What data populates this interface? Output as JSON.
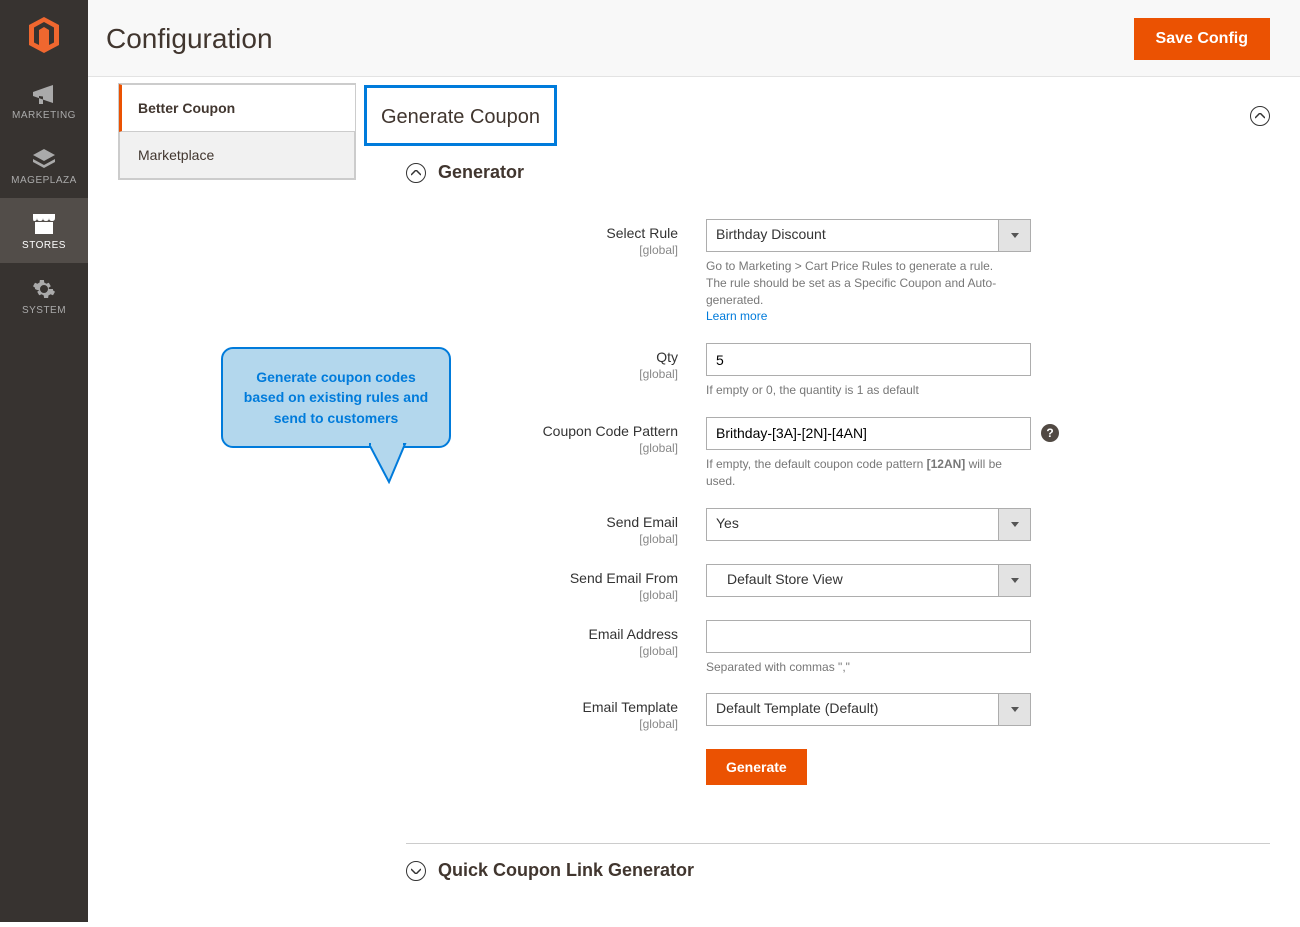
{
  "header": {
    "title": "Configuration",
    "save_label": "Save Config"
  },
  "sidebar": {
    "items": [
      {
        "label": "MARKETING"
      },
      {
        "label": "MAGEPLAZA"
      },
      {
        "label": "STORES"
      },
      {
        "label": "SYSTEM"
      }
    ]
  },
  "config_tabs": {
    "tab1": "Better Coupon",
    "tab2": "Marketplace"
  },
  "section": {
    "title": "Generate Coupon"
  },
  "collapse": {
    "generator": "Generator",
    "quicklink": "Quick Coupon Link Generator"
  },
  "callout": {
    "text": "Generate coupon codes based on existing rules and send to customers"
  },
  "form": {
    "scope": "[global]",
    "select_rule": {
      "label": "Select Rule",
      "value": "Birthday Discount",
      "note1": "Go to Marketing > Cart Price Rules to generate a rule.",
      "note2": "The rule should be set as a Specific Coupon and Auto-generated.",
      "learn": "Learn more"
    },
    "qty": {
      "label": "Qty",
      "value": "5",
      "note": "If empty or 0, the quantity is 1 as default"
    },
    "pattern": {
      "label": "Coupon Code Pattern",
      "value": "Brithday-[3A]-[2N]-[4AN]",
      "note_a": "If empty, the default coupon code pattern ",
      "note_bold": "[12AN]",
      "note_b": " will be used."
    },
    "send_email": {
      "label": "Send Email",
      "value": "Yes"
    },
    "send_from": {
      "label": "Send Email From",
      "value": "Default Store View"
    },
    "email_addr": {
      "label": "Email Address",
      "value": "",
      "note": "Separated with commas \",\""
    },
    "template": {
      "label": "Email Template",
      "value": "Default Template (Default)"
    },
    "generate_btn": "Generate"
  }
}
